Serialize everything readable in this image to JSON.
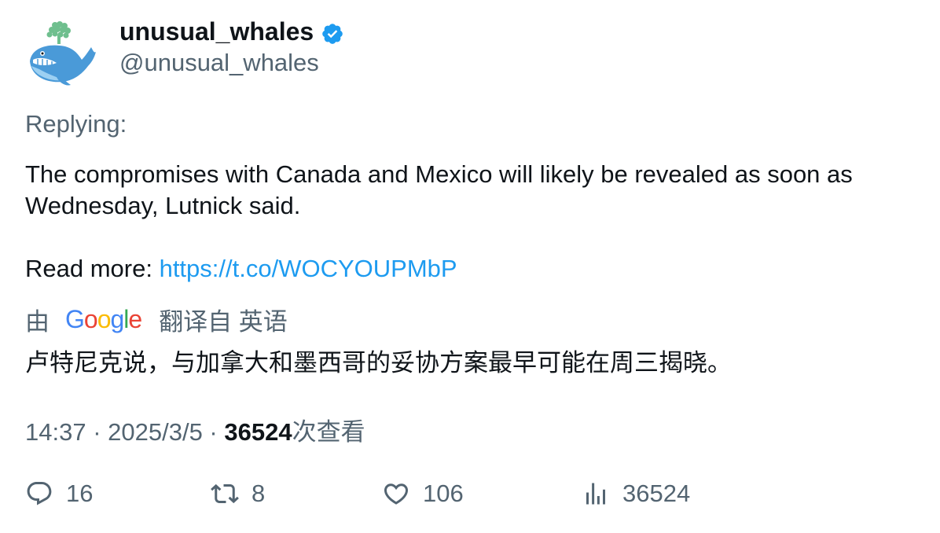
{
  "author": {
    "display_name": "unusual_whales",
    "handle": "@unusual_whales",
    "verified": true
  },
  "tweet": {
    "replying_label": "Replying:",
    "text_line1": "The compromises with Canada and Mexico will likely be revealed as soon as",
    "text_line2": "Wednesday, Lutnick said.",
    "read_more_label": "Read more: ",
    "link": "https://t.co/WOCYOUPMbP"
  },
  "translation": {
    "by_label": "由",
    "provider_logo_text": "Google",
    "translated_from_label": "翻译自 英语",
    "translated_text": "卢特尼克说，与加拿大和墨西哥的妥协方案最早可能在周三揭晓。"
  },
  "meta": {
    "time": "14:37",
    "separator": " · ",
    "date": "2025/3/5",
    "views_count": "36524",
    "views_label": "次查看"
  },
  "actions": {
    "replies": "16",
    "retweets": "8",
    "likes": "106",
    "views": "36524"
  },
  "colors": {
    "text": "#0f1419",
    "secondary": "#536471",
    "link": "#1d9bf0",
    "verified": "#1d9bf0"
  }
}
